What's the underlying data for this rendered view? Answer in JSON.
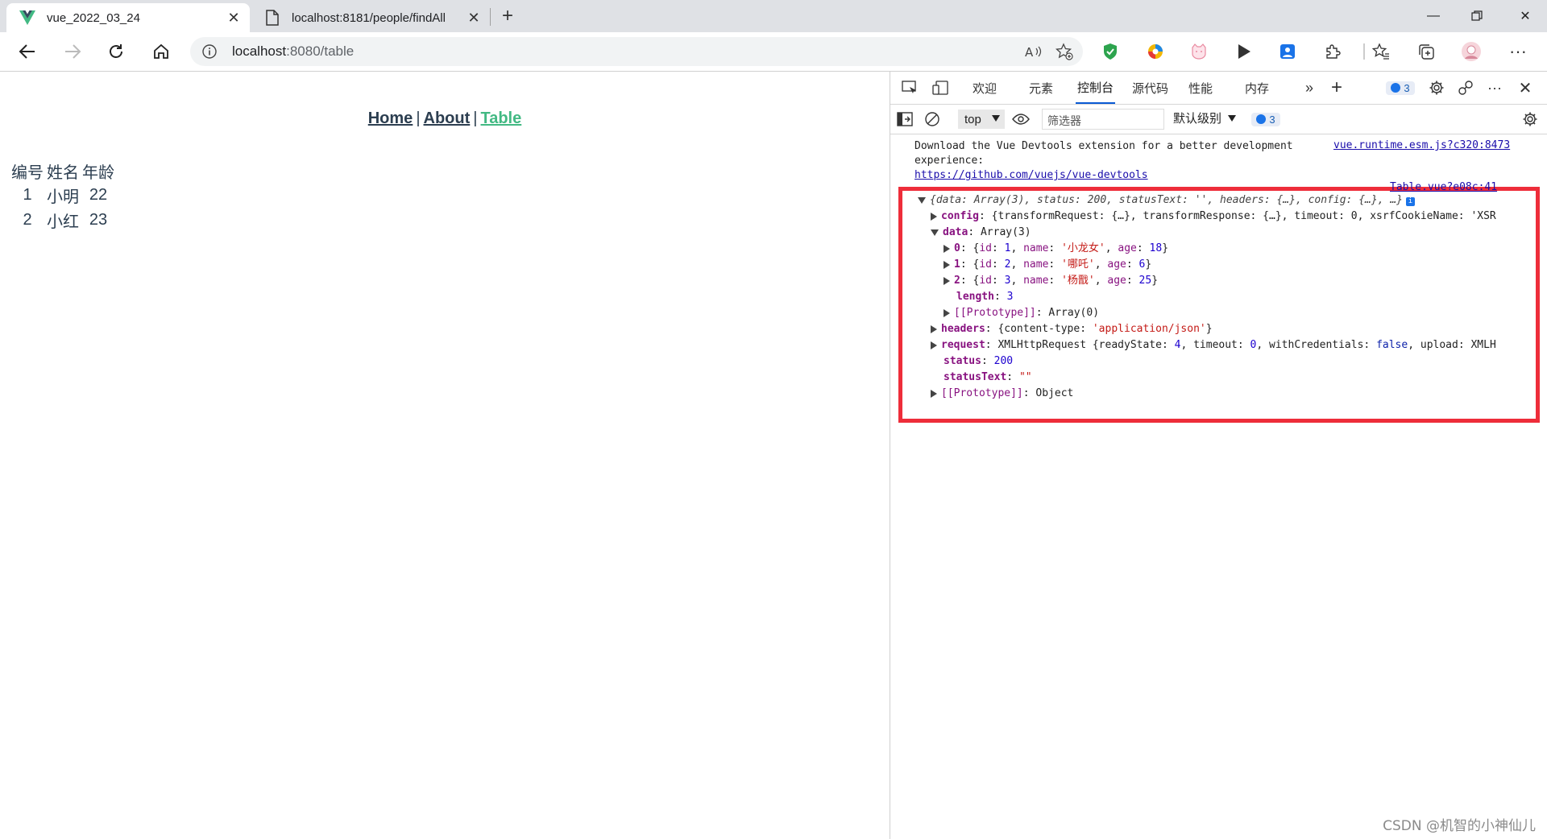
{
  "browser": {
    "tabs": [
      {
        "title": "vue_2022_03_24",
        "active": true,
        "icon": "vue-logo-icon"
      },
      {
        "title": "localhost:8181/people/findAll",
        "active": false,
        "icon": "page-icon"
      }
    ],
    "address": {
      "host": "localhost",
      "path": ":8080/table"
    }
  },
  "page": {
    "nav": {
      "home": "Home",
      "sep": "|",
      "about": "About",
      "table": "Table"
    },
    "table": {
      "headers": [
        "编号",
        "姓名",
        "年龄"
      ],
      "rows": [
        [
          "1",
          "小明",
          "22"
        ],
        [
          "2",
          "小红",
          "23"
        ]
      ]
    }
  },
  "devtools": {
    "tabs": {
      "welcome": "欢迎",
      "elements": "元素",
      "console": "控制台",
      "sources": "源代码",
      "performance": "性能",
      "memory": "内存"
    },
    "issues_count": "3",
    "context": "top",
    "filter_placeholder": "筛选器",
    "levels": "默认级别",
    "filter_issues": "3",
    "console": {
      "msg1_line1": "Download the Vue Devtools extension for a better development",
      "msg1_line2": "experience:",
      "msg1_link": "https://github.com/vuejs/vue-devtools",
      "msg1_source": "vue.runtime.esm.js?c320:8473",
      "obj_source": "Table.vue?e08c:41",
      "summary": "{data: Array(3), status: 200, statusText: '', headers: {…}, config: {…}, …}",
      "config_key": "config",
      "config_val": "{transformRequest: {…}, transformResponse: {…}, timeout: 0, xsrfCookieName: 'XSR",
      "data_key": "data",
      "data_val": "Array(3)",
      "items": [
        {
          "idx": "0",
          "id": "1",
          "name": "'小龙女'",
          "age": "18"
        },
        {
          "idx": "1",
          "id": "2",
          "name": "'哪吒'",
          "age": "6"
        },
        {
          "idx": "2",
          "id": "3",
          "name": "'杨戬'",
          "age": "25"
        }
      ],
      "length_key": "length",
      "length_val": "3",
      "proto_arr_key": "[[Prototype]]",
      "proto_arr_val": "Array(0)",
      "headers_key": "headers",
      "headers_val_pre": "{content-type: ",
      "headers_val_str": "'application/json'",
      "headers_val_post": "}",
      "request_key": "request",
      "request_val_pre": "XMLHttpRequest {readyState: ",
      "request_rs": "4",
      "request_mid1": ", timeout: ",
      "request_to": "0",
      "request_mid2": ", withCredentials: ",
      "request_wc": "false",
      "request_tail": ", upload: XMLH",
      "status_key": "status",
      "status_val": "200",
      "statusText_key": "statusText",
      "statusText_val": "\"\"",
      "proto_obj_key": "[[Prototype]]",
      "proto_obj_val": "Object"
    }
  },
  "watermark": "CSDN @机智的小神仙儿",
  "colors": {
    "vue_green": "#42b983",
    "nav_text": "#2c3e50",
    "highlight_red": "#ee2d3a",
    "devtools_blue": "#1a73e8"
  }
}
